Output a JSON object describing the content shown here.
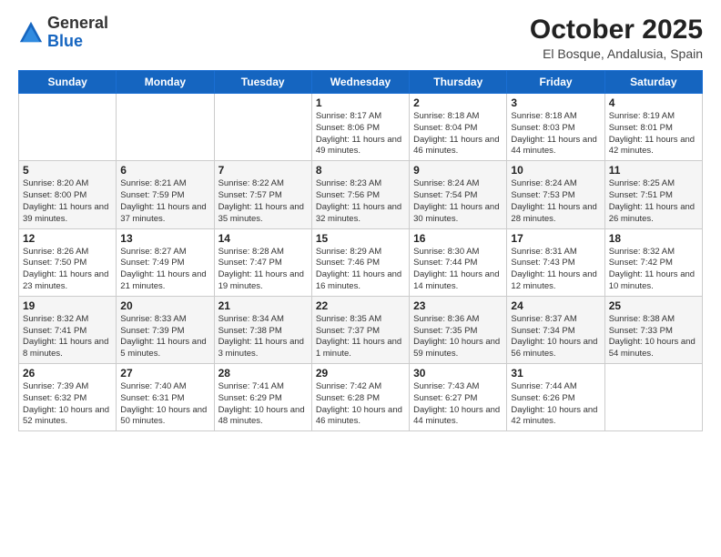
{
  "logo": {
    "general": "General",
    "blue": "Blue"
  },
  "header": {
    "title": "October 2025",
    "subtitle": "El Bosque, Andalusia, Spain"
  },
  "days_of_week": [
    "Sunday",
    "Monday",
    "Tuesday",
    "Wednesday",
    "Thursday",
    "Friday",
    "Saturday"
  ],
  "weeks": [
    [
      {
        "day": "",
        "info": ""
      },
      {
        "day": "",
        "info": ""
      },
      {
        "day": "",
        "info": ""
      },
      {
        "day": "1",
        "info": "Sunrise: 8:17 AM\nSunset: 8:06 PM\nDaylight: 11 hours and 49 minutes."
      },
      {
        "day": "2",
        "info": "Sunrise: 8:18 AM\nSunset: 8:04 PM\nDaylight: 11 hours and 46 minutes."
      },
      {
        "day": "3",
        "info": "Sunrise: 8:18 AM\nSunset: 8:03 PM\nDaylight: 11 hours and 44 minutes."
      },
      {
        "day": "4",
        "info": "Sunrise: 8:19 AM\nSunset: 8:01 PM\nDaylight: 11 hours and 42 minutes."
      }
    ],
    [
      {
        "day": "5",
        "info": "Sunrise: 8:20 AM\nSunset: 8:00 PM\nDaylight: 11 hours and 39 minutes."
      },
      {
        "day": "6",
        "info": "Sunrise: 8:21 AM\nSunset: 7:59 PM\nDaylight: 11 hours and 37 minutes."
      },
      {
        "day": "7",
        "info": "Sunrise: 8:22 AM\nSunset: 7:57 PM\nDaylight: 11 hours and 35 minutes."
      },
      {
        "day": "8",
        "info": "Sunrise: 8:23 AM\nSunset: 7:56 PM\nDaylight: 11 hours and 32 minutes."
      },
      {
        "day": "9",
        "info": "Sunrise: 8:24 AM\nSunset: 7:54 PM\nDaylight: 11 hours and 30 minutes."
      },
      {
        "day": "10",
        "info": "Sunrise: 8:24 AM\nSunset: 7:53 PM\nDaylight: 11 hours and 28 minutes."
      },
      {
        "day": "11",
        "info": "Sunrise: 8:25 AM\nSunset: 7:51 PM\nDaylight: 11 hours and 26 minutes."
      }
    ],
    [
      {
        "day": "12",
        "info": "Sunrise: 8:26 AM\nSunset: 7:50 PM\nDaylight: 11 hours and 23 minutes."
      },
      {
        "day": "13",
        "info": "Sunrise: 8:27 AM\nSunset: 7:49 PM\nDaylight: 11 hours and 21 minutes."
      },
      {
        "day": "14",
        "info": "Sunrise: 8:28 AM\nSunset: 7:47 PM\nDaylight: 11 hours and 19 minutes."
      },
      {
        "day": "15",
        "info": "Sunrise: 8:29 AM\nSunset: 7:46 PM\nDaylight: 11 hours and 16 minutes."
      },
      {
        "day": "16",
        "info": "Sunrise: 8:30 AM\nSunset: 7:44 PM\nDaylight: 11 hours and 14 minutes."
      },
      {
        "day": "17",
        "info": "Sunrise: 8:31 AM\nSunset: 7:43 PM\nDaylight: 11 hours and 12 minutes."
      },
      {
        "day": "18",
        "info": "Sunrise: 8:32 AM\nSunset: 7:42 PM\nDaylight: 11 hours and 10 minutes."
      }
    ],
    [
      {
        "day": "19",
        "info": "Sunrise: 8:32 AM\nSunset: 7:41 PM\nDaylight: 11 hours and 8 minutes."
      },
      {
        "day": "20",
        "info": "Sunrise: 8:33 AM\nSunset: 7:39 PM\nDaylight: 11 hours and 5 minutes."
      },
      {
        "day": "21",
        "info": "Sunrise: 8:34 AM\nSunset: 7:38 PM\nDaylight: 11 hours and 3 minutes."
      },
      {
        "day": "22",
        "info": "Sunrise: 8:35 AM\nSunset: 7:37 PM\nDaylight: 11 hours and 1 minute."
      },
      {
        "day": "23",
        "info": "Sunrise: 8:36 AM\nSunset: 7:35 PM\nDaylight: 10 hours and 59 minutes."
      },
      {
        "day": "24",
        "info": "Sunrise: 8:37 AM\nSunset: 7:34 PM\nDaylight: 10 hours and 56 minutes."
      },
      {
        "day": "25",
        "info": "Sunrise: 8:38 AM\nSunset: 7:33 PM\nDaylight: 10 hours and 54 minutes."
      }
    ],
    [
      {
        "day": "26",
        "info": "Sunrise: 7:39 AM\nSunset: 6:32 PM\nDaylight: 10 hours and 52 minutes."
      },
      {
        "day": "27",
        "info": "Sunrise: 7:40 AM\nSunset: 6:31 PM\nDaylight: 10 hours and 50 minutes."
      },
      {
        "day": "28",
        "info": "Sunrise: 7:41 AM\nSunset: 6:29 PM\nDaylight: 10 hours and 48 minutes."
      },
      {
        "day": "29",
        "info": "Sunrise: 7:42 AM\nSunset: 6:28 PM\nDaylight: 10 hours and 46 minutes."
      },
      {
        "day": "30",
        "info": "Sunrise: 7:43 AM\nSunset: 6:27 PM\nDaylight: 10 hours and 44 minutes."
      },
      {
        "day": "31",
        "info": "Sunrise: 7:44 AM\nSunset: 6:26 PM\nDaylight: 10 hours and 42 minutes."
      },
      {
        "day": "",
        "info": ""
      }
    ]
  ]
}
